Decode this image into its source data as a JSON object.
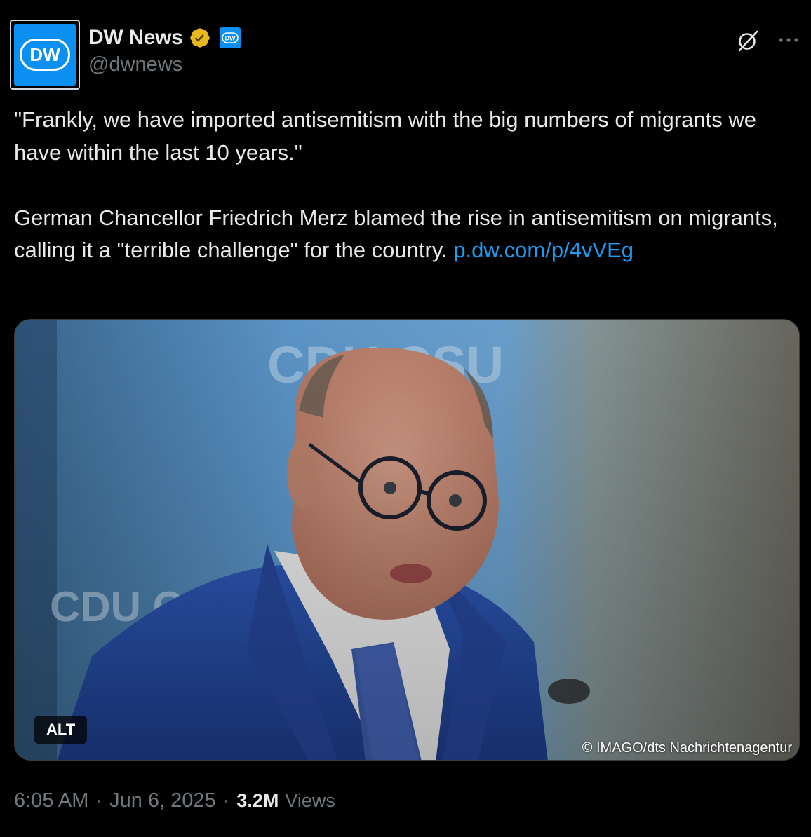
{
  "author": {
    "display_name": "DW News",
    "handle": "@dwnews",
    "avatar_text": "DW",
    "brand_color": "#0b8ff0",
    "verified_color": "#e8b81f"
  },
  "icons": {
    "verified": "verified-badge-icon",
    "affiliate": "dw-affiliate-badge-icon",
    "grok": "grok-icon",
    "more": "more-icon"
  },
  "tweet": {
    "quote": "\"Frankly, we have imported antisemitism with the big numbers of migrants we have within the last 10 years.\"",
    "body": "German Chancellor Friedrich Merz blamed the rise in antisemitism on migrants, calling it a \"terrible challenge\" for the country. ",
    "link_text": "p.dw.com/p/4vVEg",
    "link_color": "#1d9bf0"
  },
  "media": {
    "alt_label": "ALT",
    "credit": "© IMAGO/dts Nachrichtenagentur"
  },
  "meta": {
    "time": "6:05 AM",
    "date": "Jun 6, 2025",
    "separator": "·",
    "views_count": "3.2M",
    "views_label": "Views"
  }
}
